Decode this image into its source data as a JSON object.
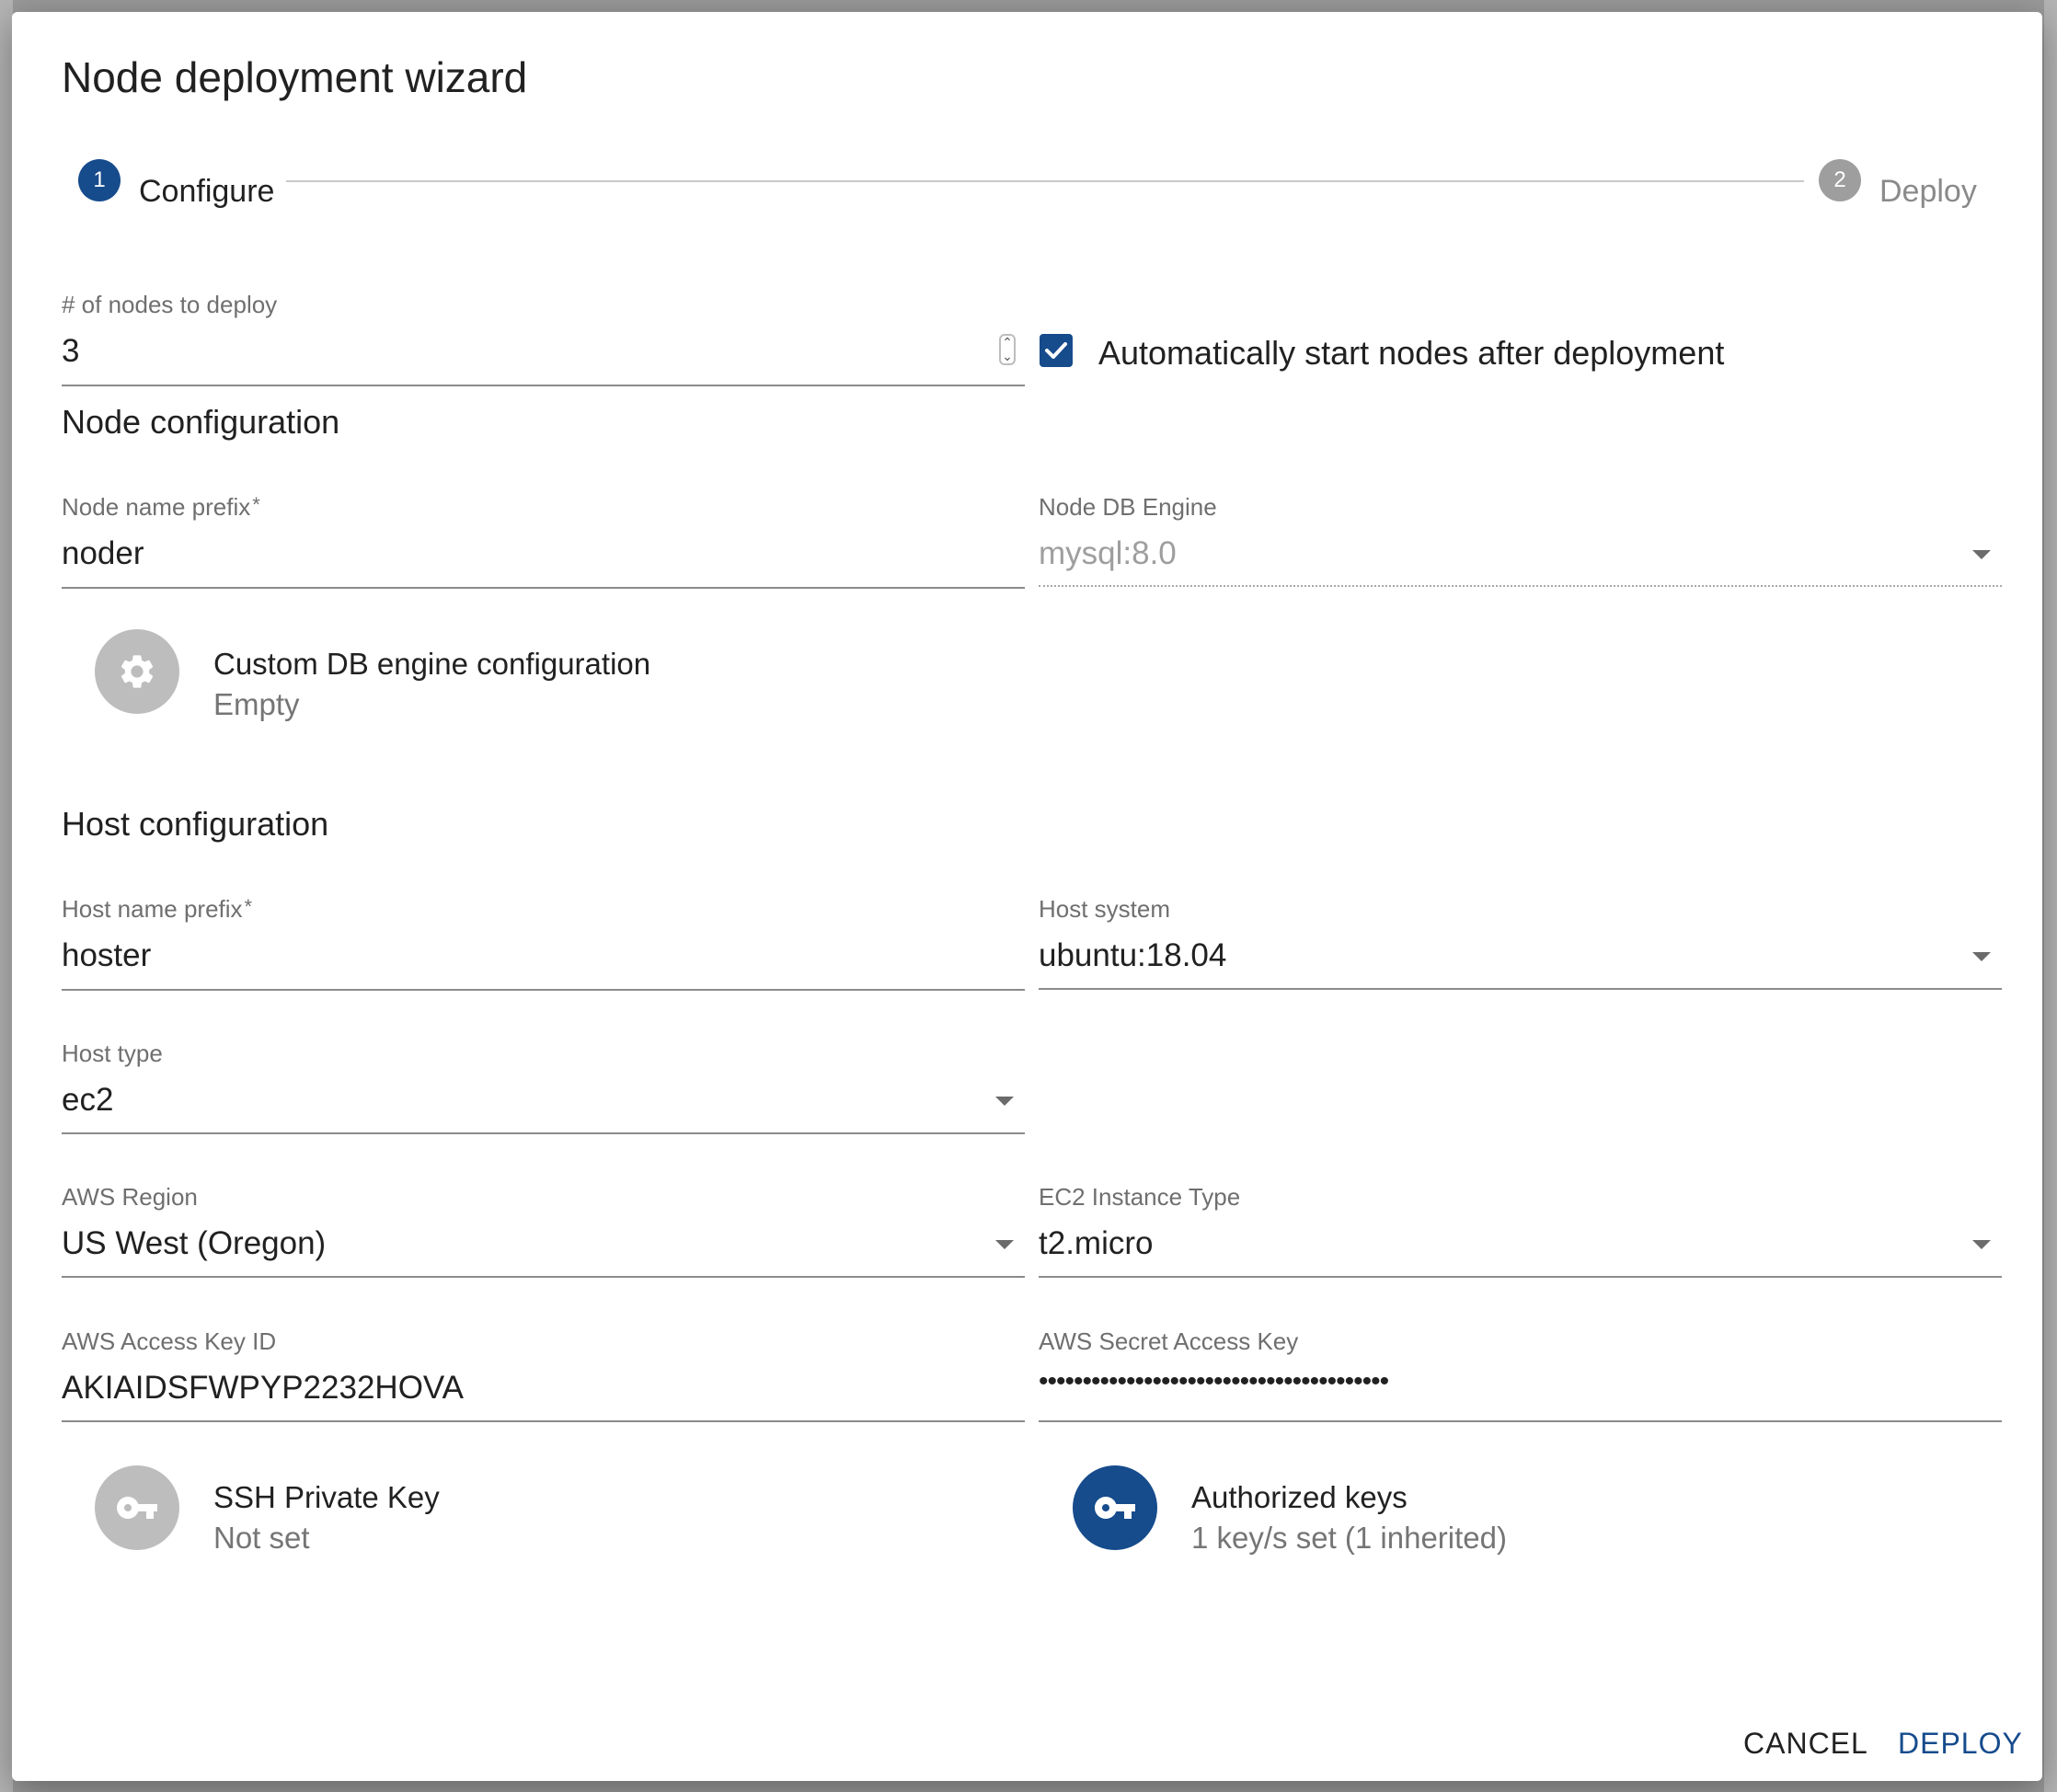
{
  "dialog": {
    "title": "Node deployment wizard",
    "accent_color": "#164b8c"
  },
  "stepper": {
    "steps": [
      {
        "number": "1",
        "label": "Configure",
        "active": true
      },
      {
        "number": "2",
        "label": "Deploy",
        "active": false
      }
    ]
  },
  "nodes_count": {
    "label": "# of nodes to deploy",
    "value": "3"
  },
  "auto_start": {
    "label": "Automatically start nodes after deployment",
    "checked": true
  },
  "node_config": {
    "section_title": "Node configuration",
    "name_prefix": {
      "label": "Node name prefix",
      "required_mark": "*",
      "value": "noder"
    },
    "db_engine": {
      "label": "Node DB Engine",
      "value": "mysql:8.0",
      "disabled": true
    },
    "custom_db": {
      "title": "Custom DB engine configuration",
      "subtitle": "Empty",
      "icon": "gear-icon"
    }
  },
  "host_config": {
    "section_title": "Host configuration",
    "name_prefix": {
      "label": "Host name prefix",
      "required_mark": "*",
      "value": "hoster"
    },
    "host_system": {
      "label": "Host system",
      "value": "ubuntu:18.04"
    },
    "host_type": {
      "label": "Host type",
      "value": "ec2"
    },
    "aws_region": {
      "label": "AWS Region",
      "value": "US West (Oregon)"
    },
    "instance_type": {
      "label": "EC2 Instance Type",
      "value": "t2.micro"
    },
    "access_key_id": {
      "label": "AWS Access Key ID",
      "value": "AKIAIDSFWPYP2232HOVA"
    },
    "secret_key": {
      "label": "AWS Secret Access Key",
      "value": "••••••••••••••••••••••••••••••••••••••••"
    },
    "ssh_key": {
      "title": "SSH Private Key",
      "subtitle": "Not set",
      "icon": "key-icon"
    },
    "authorized_keys": {
      "title": "Authorized keys",
      "subtitle": "1 key/s set (1 inherited)",
      "icon": "key-icon"
    }
  },
  "actions": {
    "cancel_label": "CANCEL",
    "deploy_label": "DEPLOY"
  }
}
